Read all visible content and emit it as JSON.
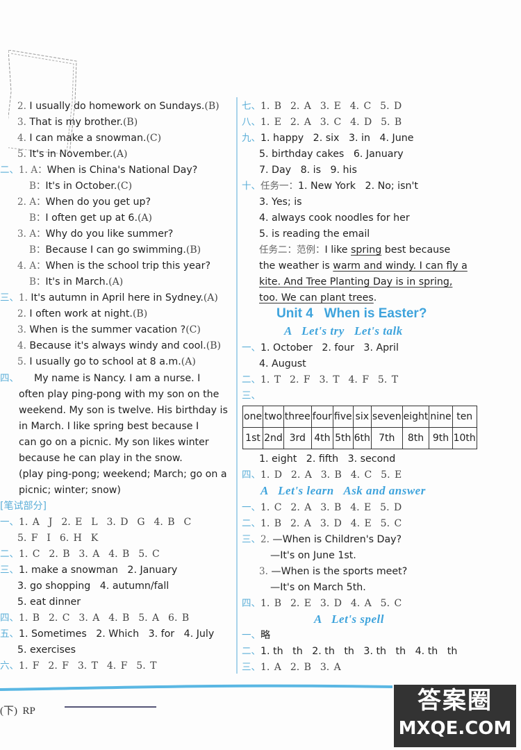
{
  "left": {
    "l1": {
      "num": "2.",
      "text": "I usually do homework on Sundays.",
      "ans": "(B)"
    },
    "l2": {
      "num": "3.",
      "text": "That is my brother.",
      "ans": "(B)"
    },
    "l3": {
      "num": "4.",
      "text": "I can make a snowman.",
      "ans": "(C)"
    },
    "l4": {
      "num": "5.",
      "text": "It's in November.",
      "ans": "(A)"
    },
    "s2": {
      "sec": "二、",
      "items": [
        {
          "num": "1.",
          "a": "A：",
          "q": "When is China's National Day?",
          "b": "B：",
          "r": "It's in October.",
          "ans": "(C)"
        },
        {
          "num": "2.",
          "a": "A：",
          "q": "When do you get up?",
          "b": "B：",
          "r": "I often get up at 6.",
          "ans": "(A)"
        },
        {
          "num": "3.",
          "a": "A：",
          "q": "Why do you like summer?",
          "b": "B：",
          "r": "Because I can go swimming.",
          "ans": "(B)"
        },
        {
          "num": "4.",
          "a": "A：",
          "q": "When is the school trip this year?",
          "b": "B：",
          "r": "It's in March.",
          "ans": "(A)"
        }
      ]
    },
    "s3": {
      "sec": "三、",
      "items": [
        {
          "num": "1.",
          "text": "It's autumn in April here in Sydney.",
          "ans": "(A)"
        },
        {
          "num": "2.",
          "text": "I often work at night.",
          "ans": "(B)"
        },
        {
          "num": "3.",
          "text": "When is the summer vacation ?",
          "ans": "(C)"
        },
        {
          "num": "4.",
          "text": "Because it's always windy and cool.",
          "ans": "(B)"
        },
        {
          "num": "5.",
          "text": "I usually go to school at 8 a.m.",
          "ans": "(A)"
        }
      ]
    },
    "s4": {
      "sec": "四、",
      "lines": [
        "My name is Nancy. I am a nurse. I",
        "often play ping-pong with my son on the",
        "weekend. My son is twelve. His birthday is",
        "in March. I like spring best because I",
        "can go on a picnic. My son likes winter",
        "because he can play in the snow.",
        "(play ping-pong; weekend; March; go on a",
        "picnic; winter; snow)"
      ]
    },
    "written_label": "[笔试部分]",
    "w1": {
      "sec": "一、",
      "line1": "1. A  J  2. E  L  3. D  G  4. B  C",
      "line2": "5. F  I  6. H  K"
    },
    "w2": {
      "sec": "二、",
      "line1": "1. C  2. B  3. A  4. B  5. C"
    },
    "w3": {
      "sec": "三、",
      "line1": "1. make a snowman   2. January",
      "line2": "3. go shopping   4. autumn/fall",
      "line3": "5. eat dinner"
    },
    "w4": {
      "sec": "四、",
      "line1": "1. B  2. C  3. A  4. B  5. A  6. B"
    },
    "w5": {
      "sec": "五、",
      "line1": "1. Sometimes   2. Which   3. for   4. July",
      "line2": "5. exercises"
    },
    "w6": {
      "sec": "六、",
      "line1": "1. F  2. F  3. T  4. F  5. T"
    }
  },
  "right": {
    "s7": {
      "sec": "七、",
      "line1": "1. B  2. A  3. E  4. C  5. D"
    },
    "s8": {
      "sec": "八、",
      "line1": "1. E  2. A  3. C  4. D  5. B"
    },
    "s9": {
      "sec": "九、",
      "line1": "1. happy   2. six   3. in   4. June",
      "line2": "5. birthday cakes   6. January",
      "line3": "7. Day   8. is   9. his"
    },
    "s10": {
      "sec": "十、",
      "task1": "任务一：",
      "line1": "1. New York   2. No; isn't",
      "line2": "3. Yes; is",
      "line3": "4. always cook noodles for her",
      "line4": "5. is reading the email",
      "task2": "任务二：范例：",
      "p1a": "I like ",
      "p1u": "spring",
      "p1b": " best because",
      "p2a": "the weather is ",
      "p2u": "warm and windy. I can fly a",
      "p3u": "kite. And Tree Planting Day is in spring,",
      "p4u": "too. We can plant trees",
      "p4b": "."
    },
    "unit_title": "Unit 4   When is Easter?",
    "sub1": "A   Let's try   Let's talk",
    "u1": {
      "sec": "一、",
      "line1": "1. October   2. four   3. April",
      "line2": "4. August"
    },
    "u2": {
      "sec": "二、",
      "line1": "1. T  2. F  3. T  4. F  5. T"
    },
    "u3": {
      "sec": "三、",
      "table": {
        "row1": [
          "one",
          "two",
          "three",
          "four",
          "five",
          "six",
          "seven",
          "eight",
          "nine",
          "ten"
        ],
        "row2": [
          "1st",
          "2nd",
          "3rd",
          "4th",
          "5th",
          "6th",
          "7th",
          "8th",
          "9th",
          "10th"
        ]
      },
      "line1": "1. eight   2. fifth   3. second"
    },
    "u4": {
      "sec": "四、",
      "line1": "1. D  2. A  3. B  4. C  5. E"
    },
    "sub2": "A   Let's learn   Ask and answer",
    "v1": {
      "sec": "一、",
      "line1": "1. C  2. A  3. B  4. E  5. D"
    },
    "v2": {
      "sec": "二、",
      "line1": "1. B  2. A  3. D  4. E  5. C"
    },
    "v3": {
      "sec": "三、",
      "n2": "2.",
      "q2": "—When is Children's Day?",
      "a2": "—It's on June 1st.",
      "n3": "3.",
      "q3": "—When is the sports meet?",
      "a3": "—It's on March 5th."
    },
    "v4": {
      "sec": "四、",
      "line1": "1. B  2. E  3. D  4. A  5. C"
    },
    "sub3": "A   Let's spell",
    "x1": {
      "sec": "一、",
      "line1": "略"
    },
    "x2": {
      "sec": "二、",
      "line1": "1. th   th   2. th   th   3. th   th   4. th   th"
    },
    "x3": {
      "sec": "三、",
      "line1": "1. A  2. B  3. A"
    }
  },
  "footer": {
    "text": "(下)  RP"
  },
  "watermark": {
    "line1": "答案圈",
    "line2": "MXQE.COM"
  }
}
